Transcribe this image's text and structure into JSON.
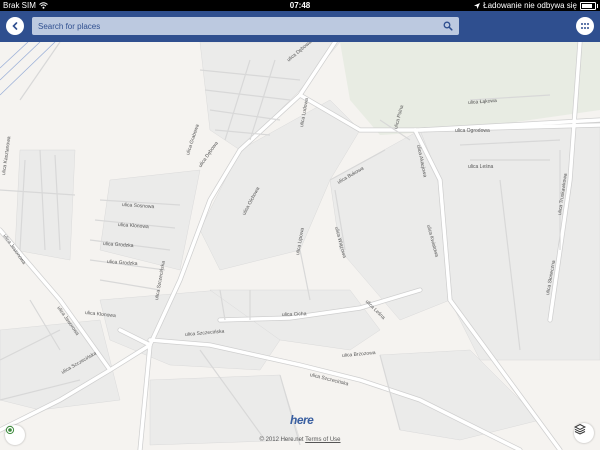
{
  "status_bar": {
    "carrier": "Brak SIM",
    "time": "07:48",
    "sync_status": "Ładowanie nie odbywa się"
  },
  "toolbar": {
    "search_placeholder": "Search for places"
  },
  "map": {
    "street_labels": [
      "ulica Dębowa",
      "ulica Grabowa",
      "ulica Dębowa",
      "ulica Ludowa",
      "ulica Olchowa",
      "ulica Szczecińska",
      "ulica Sosnowa",
      "ulica Klonowa",
      "ulica Grodzka",
      "ulica Grodzka",
      "ulica Klonowa",
      "ulica Kasztanowa",
      "ulica Jesionowa",
      "ulica Jaworowa",
      "ulica Lipowa",
      "ulica Wiązowa",
      "ulica Bukowa",
      "ulica Cicha",
      "ulica Szczecińska",
      "ulica Szczecińska",
      "ulica Szczecińska",
      "ulica Brzozowa",
      "ulica Leśna",
      "ulica Polna",
      "ulica Łąkowa",
      "ulica Ogrodowa",
      "ulica Leśna",
      "ulica Akacjowa",
      "ulica Kwiatowa",
      "ulica Słoneczna",
      "ulica Truskawkowa"
    ]
  },
  "footer": {
    "logo": "here",
    "copyright": "© 2012 Here.net",
    "terms_link": "Terms of Use"
  },
  "colors": {
    "toolbar": "#2f4f8f",
    "search_field": "#bcc9e0",
    "map_background": "#f5f3f0",
    "block_fill": "#ebebea",
    "road": "#ffffff",
    "road_outline": "#cfcfcf"
  },
  "icons": {
    "back": "chevron-left-icon",
    "search": "magnifier-icon",
    "menu": "grid-icon",
    "locate": "location-target-icon",
    "layers": "layers-icon",
    "wifi": "wifi-icon",
    "location_arrow": "location-arrow-icon",
    "battery": "battery-icon"
  }
}
